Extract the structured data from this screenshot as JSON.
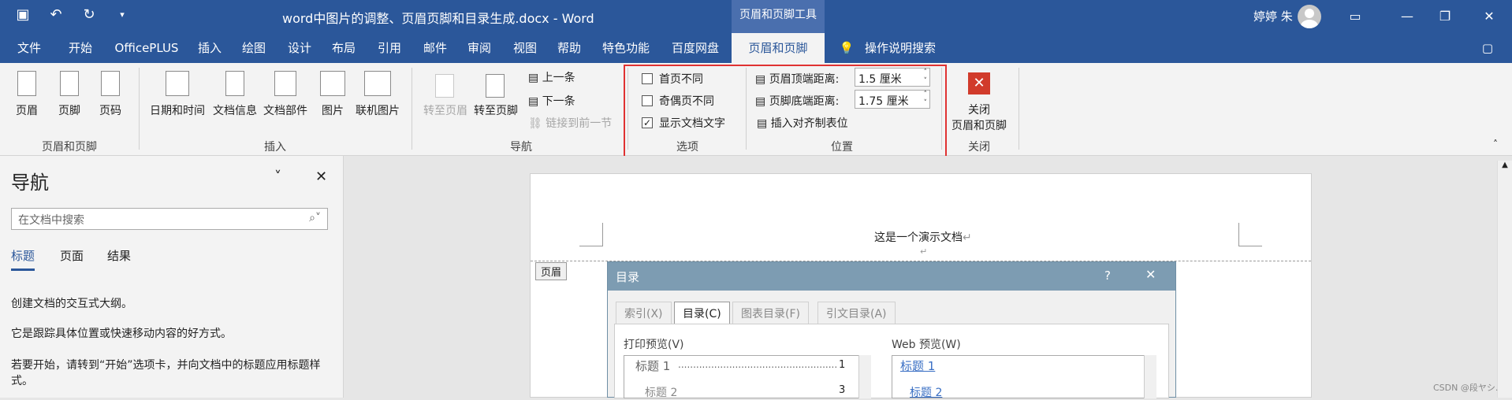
{
  "titlebar": {
    "doc_title": "word中图片的调整、页眉页脚和目录生成.docx - Word",
    "context_tab_title": "页眉和页脚工具",
    "user_name": "婷婷 朱"
  },
  "tabs": [
    "文件",
    "开始",
    "OfficePLUS",
    "插入",
    "绘图",
    "设计",
    "布局",
    "引用",
    "邮件",
    "审阅",
    "视图",
    "帮助",
    "特色功能",
    "百度网盘",
    "页眉和页脚",
    "操作说明搜索"
  ],
  "ribbon": {
    "group1": {
      "label": "页眉和页脚",
      "buttons": [
        "页眉",
        "页脚",
        "页码"
      ]
    },
    "group2": {
      "label": "插入",
      "buttons": [
        "日期和时间",
        "文档信息",
        "文档部件",
        "图片",
        "联机图片"
      ]
    },
    "group3": {
      "label": "导航",
      "goto_header": "转至页眉",
      "goto_footer": "转至页脚",
      "prev": "上一条",
      "next": "下一条",
      "link_prev": "链接到前一节"
    },
    "group4": {
      "label": "选项",
      "options": [
        {
          "label": "首页不同",
          "checked": false
        },
        {
          "label": "奇偶页不同",
          "checked": false
        },
        {
          "label": "显示文档文字",
          "checked": true
        }
      ]
    },
    "group5": {
      "label": "位置",
      "header_top": "页眉顶端距离:",
      "header_top_value": "1.5 厘米",
      "footer_bottom": "页脚底端距离:",
      "footer_bottom_value": "1.75 厘米",
      "insert_align_tab": "插入对齐制表位"
    },
    "group6": {
      "label": "关闭",
      "close_label_1": "关闭",
      "close_label_2": "页眉和页脚"
    }
  },
  "nav_pane": {
    "title": "导航",
    "search_placeholder": "在文档中搜索",
    "tabs": [
      "标题",
      "页面",
      "结果"
    ],
    "p1": "创建文档的交互式大纲。",
    "p2": "它是跟踪具体位置或快速移动内容的好方式。",
    "p3": "若要开始，请转到“开始”选项卡，并向文档中的标题应用标题样式。"
  },
  "document": {
    "header_text": "这是一个演示文档",
    "header_tag": "页眉"
  },
  "toc_dialog": {
    "title": "目录",
    "help": "?",
    "tabs": [
      "索引(X)",
      "目录(C)",
      "图表目录(F)",
      "引文目录(A)"
    ],
    "print_preview_label": "打印预览(V)",
    "print_h1": "标题 1",
    "print_h1_page": "1",
    "print_h2": "标题 2",
    "print_h2_page": "3",
    "web_preview_label": "Web 预览(W)",
    "web_h1": "标题 1",
    "web_h2": "标题 2"
  },
  "watermark": "CSDN @段ヤシ."
}
